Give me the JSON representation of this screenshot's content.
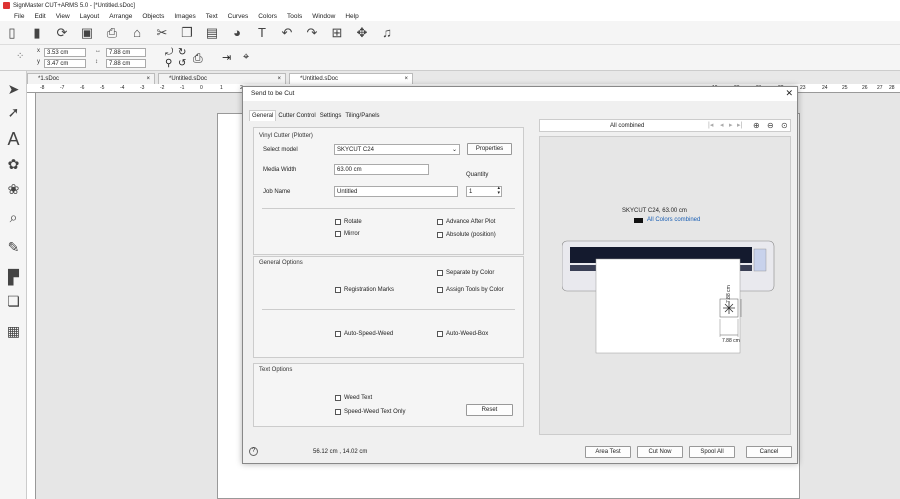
{
  "window": {
    "title": "SignMaster CUT+ARMS 5.0 - [*Untitled.sDoc]"
  },
  "menu": [
    "File",
    "Edit",
    "View",
    "Layout",
    "Arrange",
    "Objects",
    "Images",
    "Text",
    "Curves",
    "Colors",
    "Tools",
    "Window",
    "Help"
  ],
  "position": {
    "x": "3.53 cm",
    "y": "3.47 cm",
    "w": "7.88 cm",
    "h": "7.88 cm"
  },
  "doc_tabs": [
    "*1.sDoc",
    "*Untitled.sDoc",
    "*Untitled.sDoc"
  ],
  "ruler": {
    "top": [
      "-8",
      "-7",
      "-6",
      "-5",
      "-4",
      "-3",
      "-2",
      "-1",
      "0",
      "1",
      "2",
      "19",
      "20",
      "21",
      "22",
      "23",
      "24",
      "25",
      "26",
      "27",
      "28"
    ]
  },
  "dialog": {
    "title": "Send to be Cut",
    "tabs": [
      "General",
      "Cutter Control",
      "Settings",
      "Tiling/Panels"
    ],
    "vinyl_section": "Vinyl Cutter (Plotter)",
    "select_model_label": "Select model",
    "select_model_value": "SKYCUT C24",
    "properties_btn": "Properties",
    "media_width_label": "Media Width",
    "media_width_value": "63.00 cm",
    "job_name_label": "Job Name",
    "job_name_value": "Untitled",
    "quantity_label": "Quantity",
    "quantity_value": "1",
    "cb_rotate": "Rotate",
    "cb_mirror": "Mirror",
    "cb_advance": "Advance After Plot",
    "cb_absolute": "Absolute (position)",
    "general_options": "General Options",
    "cb_separate": "Separate by Color",
    "cb_reg_marks": "Registration Marks",
    "cb_assign_tools": "Assign Tools by Color",
    "cb_auto_speed_weed": "Auto-Speed-Weed",
    "cb_auto_weed_box": "Auto-Weed-Box",
    "text_options": "Text Options",
    "cb_weed_text": "Weed Text",
    "cb_speed_weed_text": "Speed-Weed Text Only",
    "reset_btn": "Reset",
    "coords": "56.12 cm , 14.02 cm",
    "area_test_btn": "Area Test",
    "cut_now_btn": "Cut Now",
    "spool_btn": "Spool All",
    "cancel_btn": "Cancel",
    "help": "?",
    "preview_combo": "All combined",
    "preview_device": "SKYCUT C24,  63.00 cm",
    "preview_legend": "All Colors combined",
    "dim_width": "7.88 cm",
    "dim_height": "7.88 cm"
  },
  "colors": {
    "accent": "#1a5fb4",
    "legend_swatch": "#111111"
  }
}
